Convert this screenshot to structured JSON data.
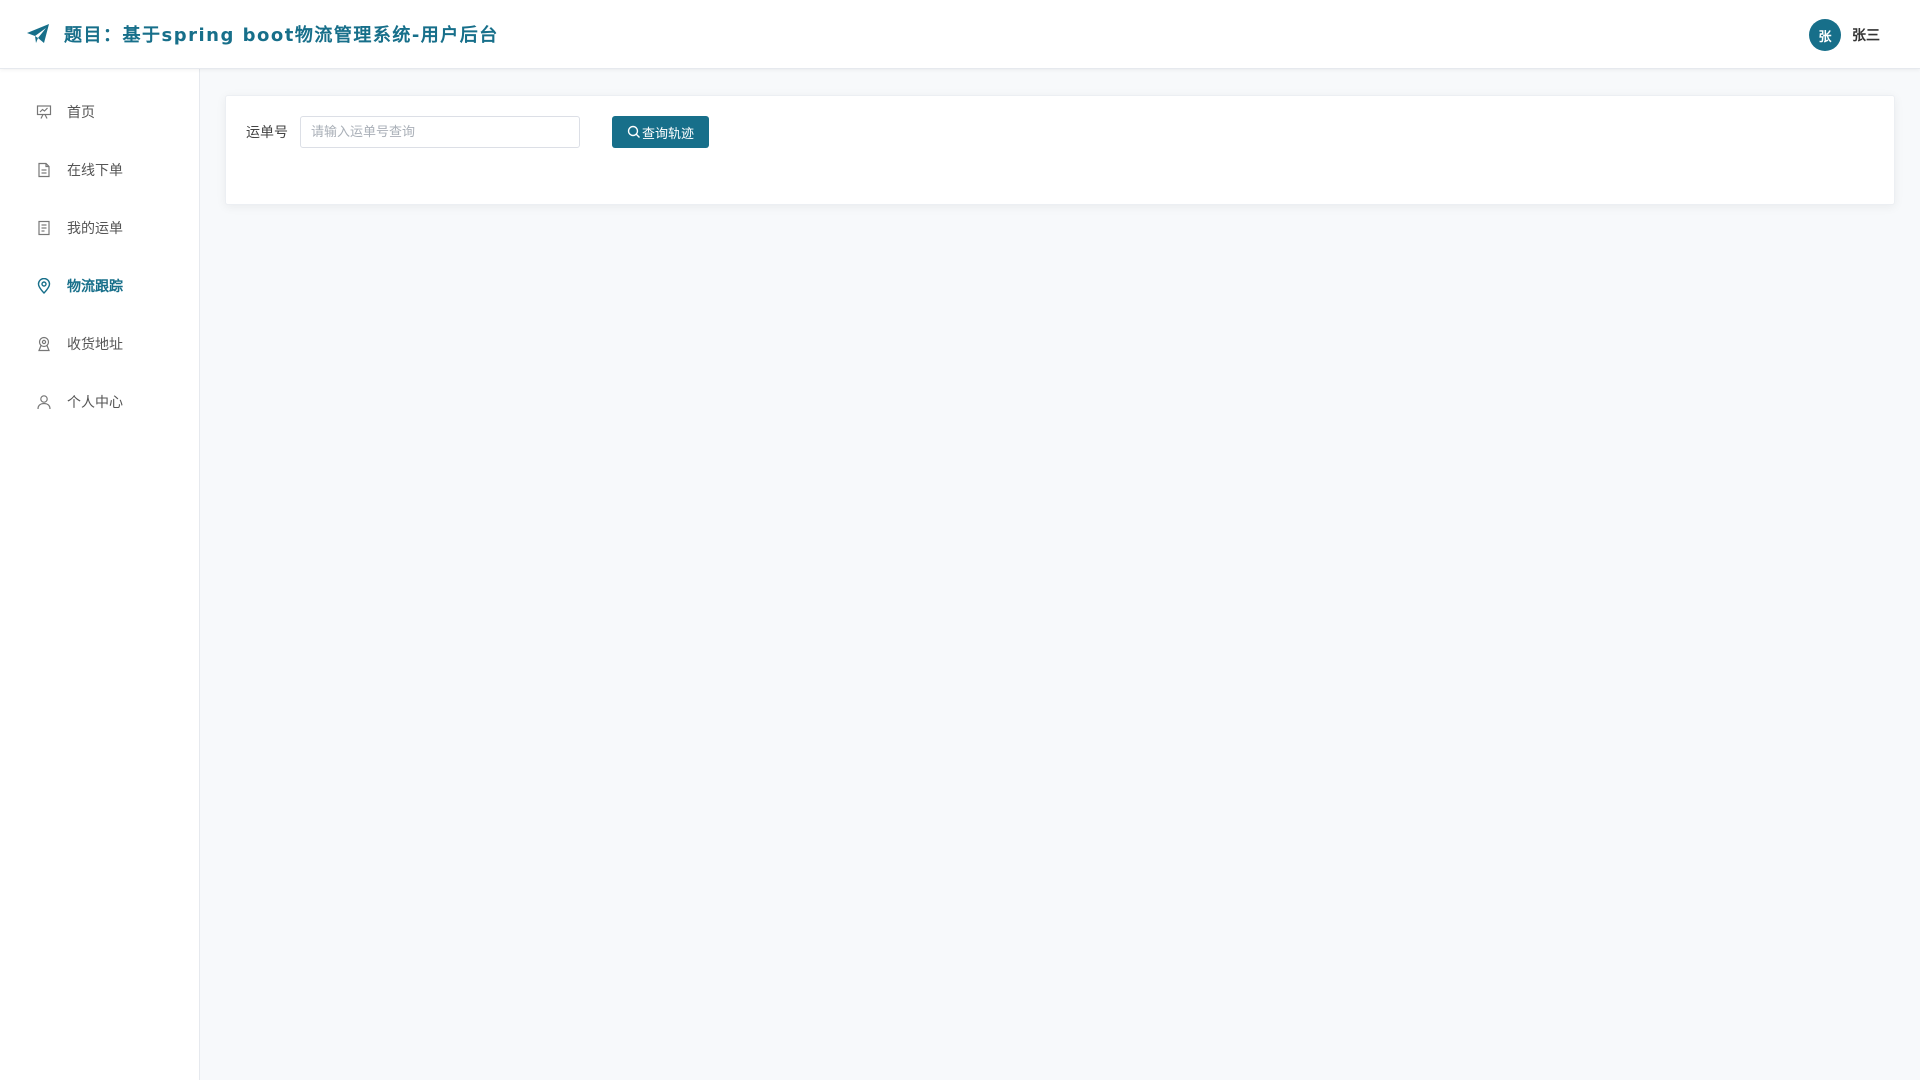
{
  "app": {
    "title": "题目：基于spring boot物流管理系统-用户后台",
    "brand_icon": "paper-plane-icon",
    "accent_color": "#176f8a"
  },
  "user": {
    "avatar_text": "张",
    "name": "张三"
  },
  "sidebar": {
    "items": [
      {
        "label": "首页",
        "icon": "presentation-chart-icon",
        "active": false
      },
      {
        "label": "在线下单",
        "icon": "document-icon",
        "active": false
      },
      {
        "label": "我的运单",
        "icon": "list-document-icon",
        "active": false
      },
      {
        "label": "物流跟踪",
        "icon": "location-pin-icon",
        "active": true
      },
      {
        "label": "收货地址",
        "icon": "address-pin-icon",
        "active": false
      },
      {
        "label": "个人中心",
        "icon": "user-icon",
        "active": false
      }
    ]
  },
  "search": {
    "label": "运单号",
    "value": "",
    "placeholder": "请输入运单号查询",
    "button_label": "查询轨迹",
    "button_icon": "search-icon"
  }
}
